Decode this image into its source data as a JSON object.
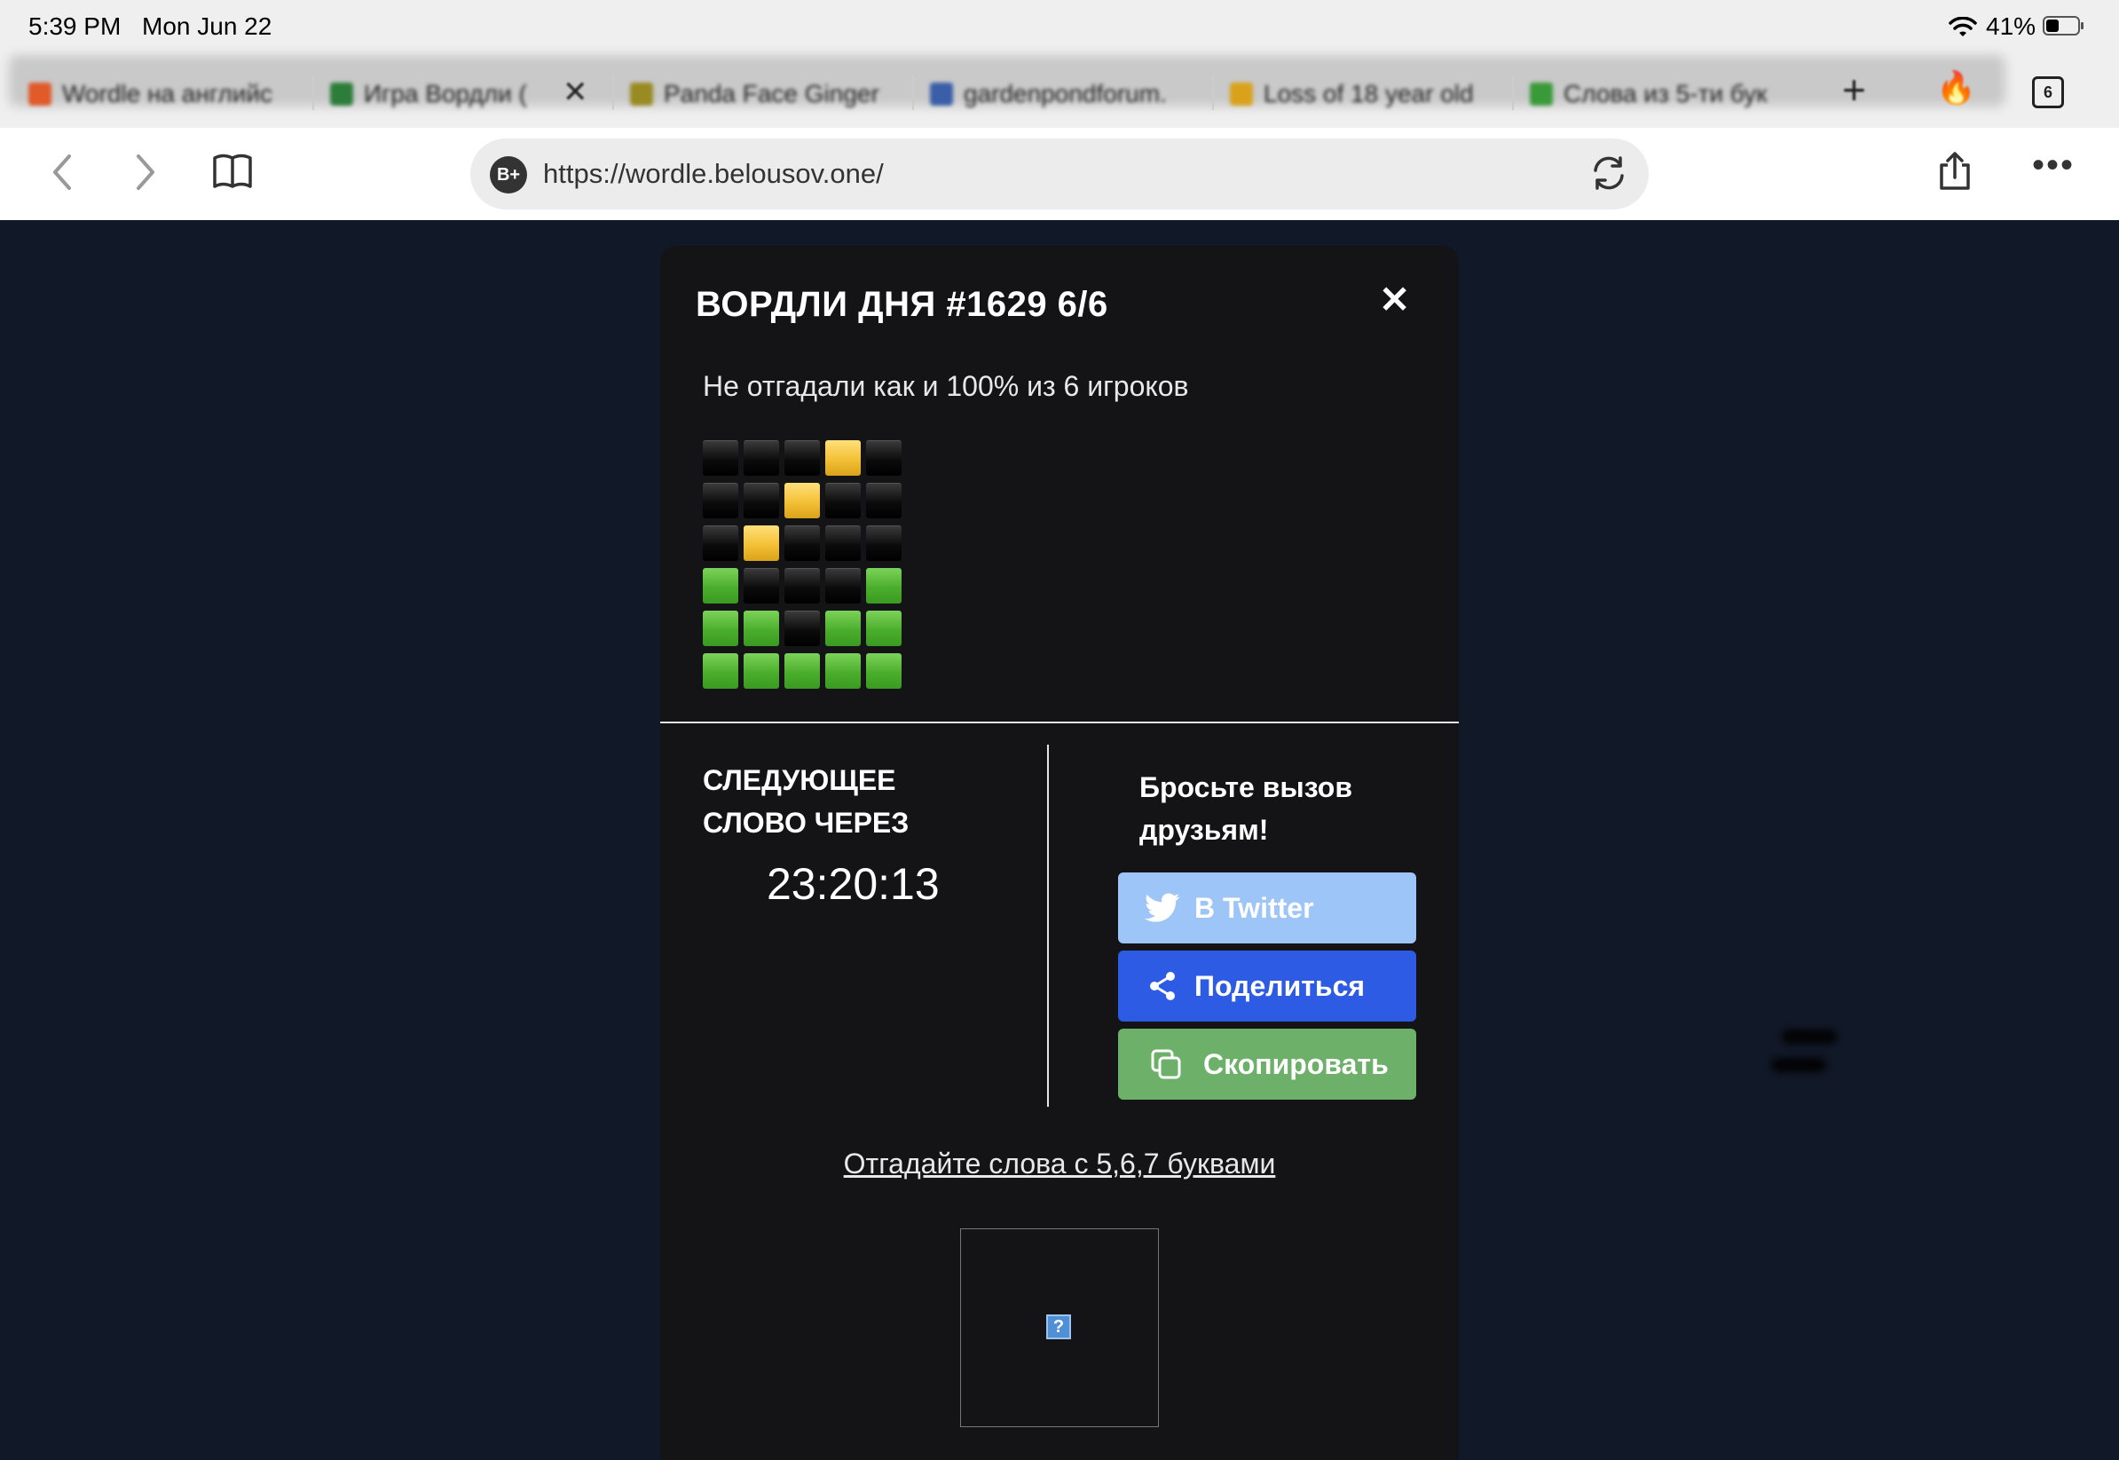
{
  "status_bar": {
    "time": "5:39 PM",
    "date": "Mon Jun 22",
    "battery_percent": "41%",
    "battery_level": 0.41
  },
  "tabs": [
    {
      "label": "Wordle на английс",
      "favicon_color": "#e05a2a"
    },
    {
      "label": "Игра Вордли (",
      "favicon_color": "#2d7d3a",
      "active": true
    },
    {
      "label": "Panda Face Ginger",
      "favicon_color": "#9a8a22"
    },
    {
      "label": "gardenpondforum.",
      "favicon_color": "#3a5fa8"
    },
    {
      "label": "Loss of 18 year old",
      "favicon_color": "#d9a21a"
    },
    {
      "label": "Слова из 5-ти бук",
      "favicon_color": "#3a9a3a"
    }
  ],
  "tab_count": "6",
  "toolbar": {
    "site_badge": "B+",
    "url": "https://wordle.belousov.one/"
  },
  "modal": {
    "title": "ВОРДЛИ ДНЯ #1629 6/6",
    "close_symbol": "✕",
    "result_text": "Не отгадали как и 100% из 6 игроков",
    "grid": [
      [
        "black",
        "black",
        "black",
        "yellow",
        "black"
      ],
      [
        "black",
        "black",
        "yellow",
        "black",
        "black"
      ],
      [
        "black",
        "yellow",
        "black",
        "black",
        "black"
      ],
      [
        "green",
        "black",
        "black",
        "black",
        "green"
      ],
      [
        "green",
        "green",
        "black",
        "green",
        "green"
      ],
      [
        "green",
        "green",
        "green",
        "green",
        "green"
      ]
    ],
    "next_word_label_line1": "СЛЕДУЮЩЕЕ",
    "next_word_label_line2": "СЛОВО ЧЕРЕЗ",
    "countdown": "23:20:13",
    "challenge_line1": "Бросьте вызов",
    "challenge_line2": "друзьям!",
    "twitter_label": "В Twitter",
    "share_label": "Поделиться",
    "copy_label": "Скопировать",
    "more_words_link": "Отгадайте слова с 5,6,7 буквами",
    "ad_placeholder_symbol": "?"
  },
  "colors": {
    "page_bg": "#111827",
    "modal_bg": "#141416",
    "twitter": "#9ec5f7",
    "share": "#2d5be3",
    "copy": "#6db06a",
    "tile_green": "#4cae2c",
    "tile_yellow": "#f4c136",
    "tile_black": "#000000"
  }
}
